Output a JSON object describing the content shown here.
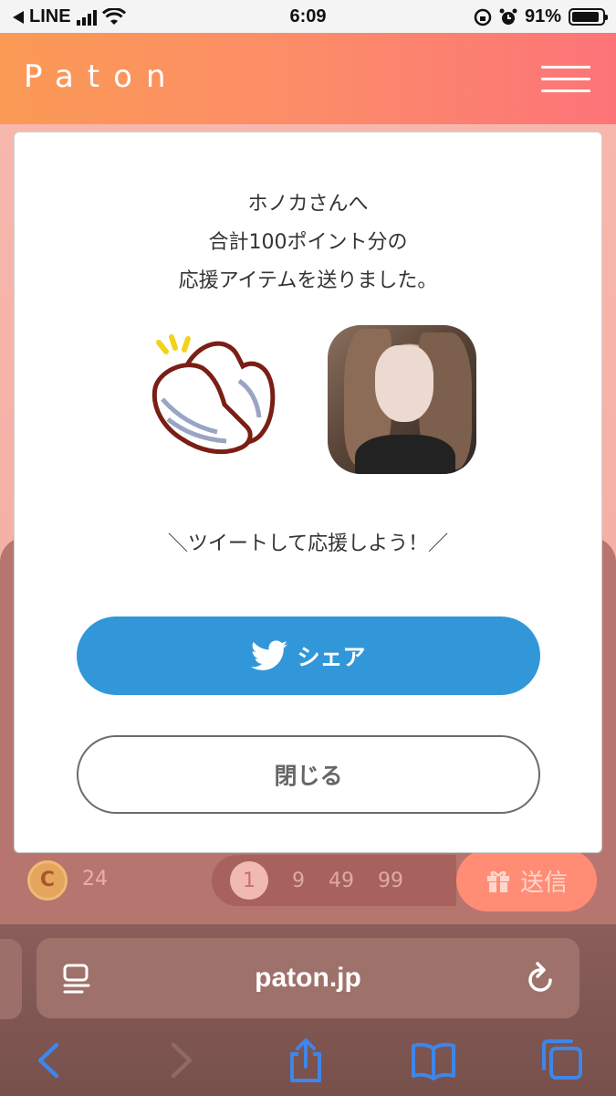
{
  "status_bar": {
    "back_app": "LINE",
    "time": "6:09",
    "battery": "91%"
  },
  "header": {
    "logo": "Paton"
  },
  "modal": {
    "message_lines": [
      "ホノカさんへ",
      "合計100ポイント分の",
      "応援アイテムを送りました。"
    ],
    "tweet_cta": "＼ツイートして応援しよう！／",
    "share_label": "シェア",
    "close_label": "閉じる"
  },
  "background_page": {
    "coin_letter": "C",
    "coin_count": "24",
    "amounts": [
      "1",
      "9",
      "49",
      "99"
    ],
    "selected_amount": "1",
    "send_label": "送信"
  },
  "browser": {
    "url": "paton.jp"
  },
  "colors": {
    "header_start": "#fb9a55",
    "header_end": "#fd7478",
    "share": "#3297d8",
    "send": "#ff8c74"
  },
  "icons": [
    "back-triangle-icon",
    "signal-icon",
    "wifi-icon",
    "screen-lock-icon",
    "alarm-icon",
    "battery-icon",
    "hamburger-icon",
    "clap-icon",
    "twitter-bird-icon",
    "gift-icon",
    "reader-icon",
    "reload-icon",
    "back-icon",
    "forward-icon",
    "share-icon",
    "bookmarks-icon",
    "tabs-icon"
  ]
}
